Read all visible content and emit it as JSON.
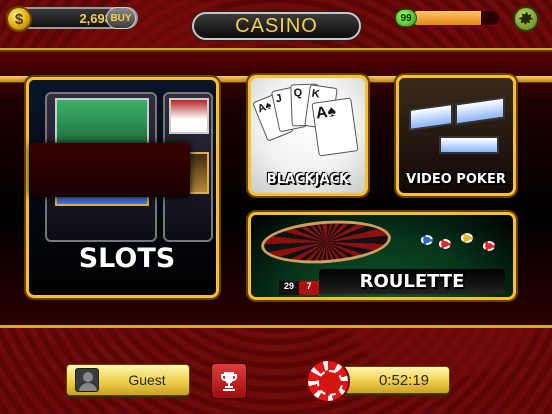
{
  "header": {
    "coins": "2,698",
    "buy_label": "BUY",
    "title": "CASINO",
    "level": "99",
    "xp_progress": 0.8
  },
  "games": {
    "slots": {
      "label": "SLOTS"
    },
    "blackjack": {
      "label": "BLACKJACK",
      "cards": [
        "A♠",
        "J",
        "Q",
        "K",
        "10",
        "A♠"
      ]
    },
    "video_poker": {
      "label": "VIDEO POKER"
    },
    "roulette": {
      "label": "ROULETTE",
      "numbers": [
        "29",
        "7"
      ]
    }
  },
  "footer": {
    "user_name": "Guest",
    "timer": "0:52:19"
  },
  "colors": {
    "gold_border": "#f5c12e",
    "background_red": "#6e0a0a",
    "coin_text": "#f5d04a",
    "xp_fill": "#e48a12",
    "level_green": "#2e9a12"
  },
  "icons": [
    "coin-icon",
    "settings-gear-icon",
    "user-avatar-icon",
    "trophy-icon",
    "poker-chip-icon"
  ]
}
